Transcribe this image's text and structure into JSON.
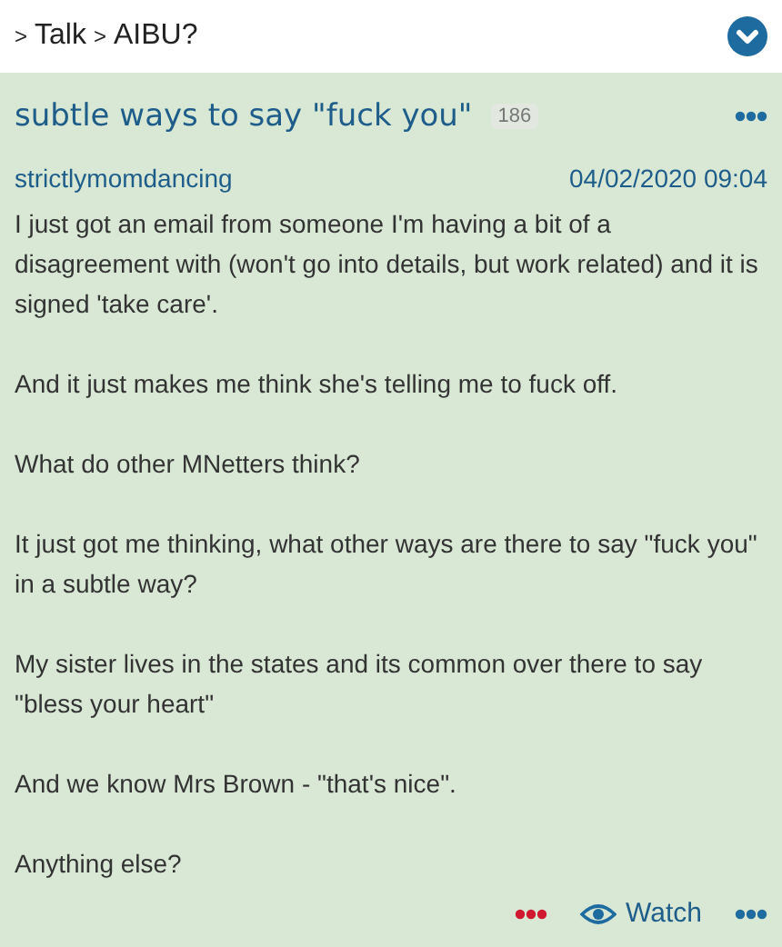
{
  "breadcrumb": [
    {
      "separator": ">",
      "label": "Talk"
    },
    {
      "separator": ">",
      "label": "AIBU?"
    }
  ],
  "thread": {
    "title": "subtle ways to say \"fuck you\"",
    "reply_count": "186"
  },
  "post": {
    "author": "strictlymomdancing",
    "date": "04/02/2020 09:04",
    "paragraphs": [
      "I just got an email from someone I'm having a bit of a disagreement with (won't go into details, but work related) and it is signed 'take care'.",
      "And it just makes me think she's telling me to fuck off.",
      "What do other MNetters think?",
      "It just got me thinking, what other ways are there to say \"fuck you\" in a subtle way?",
      "My sister lives in the states and its common over there to say \"bless your heart\"",
      "And we know Mrs Brown - \"that's nice\".",
      "Anything else?"
    ],
    "watch_label": "Watch"
  }
}
